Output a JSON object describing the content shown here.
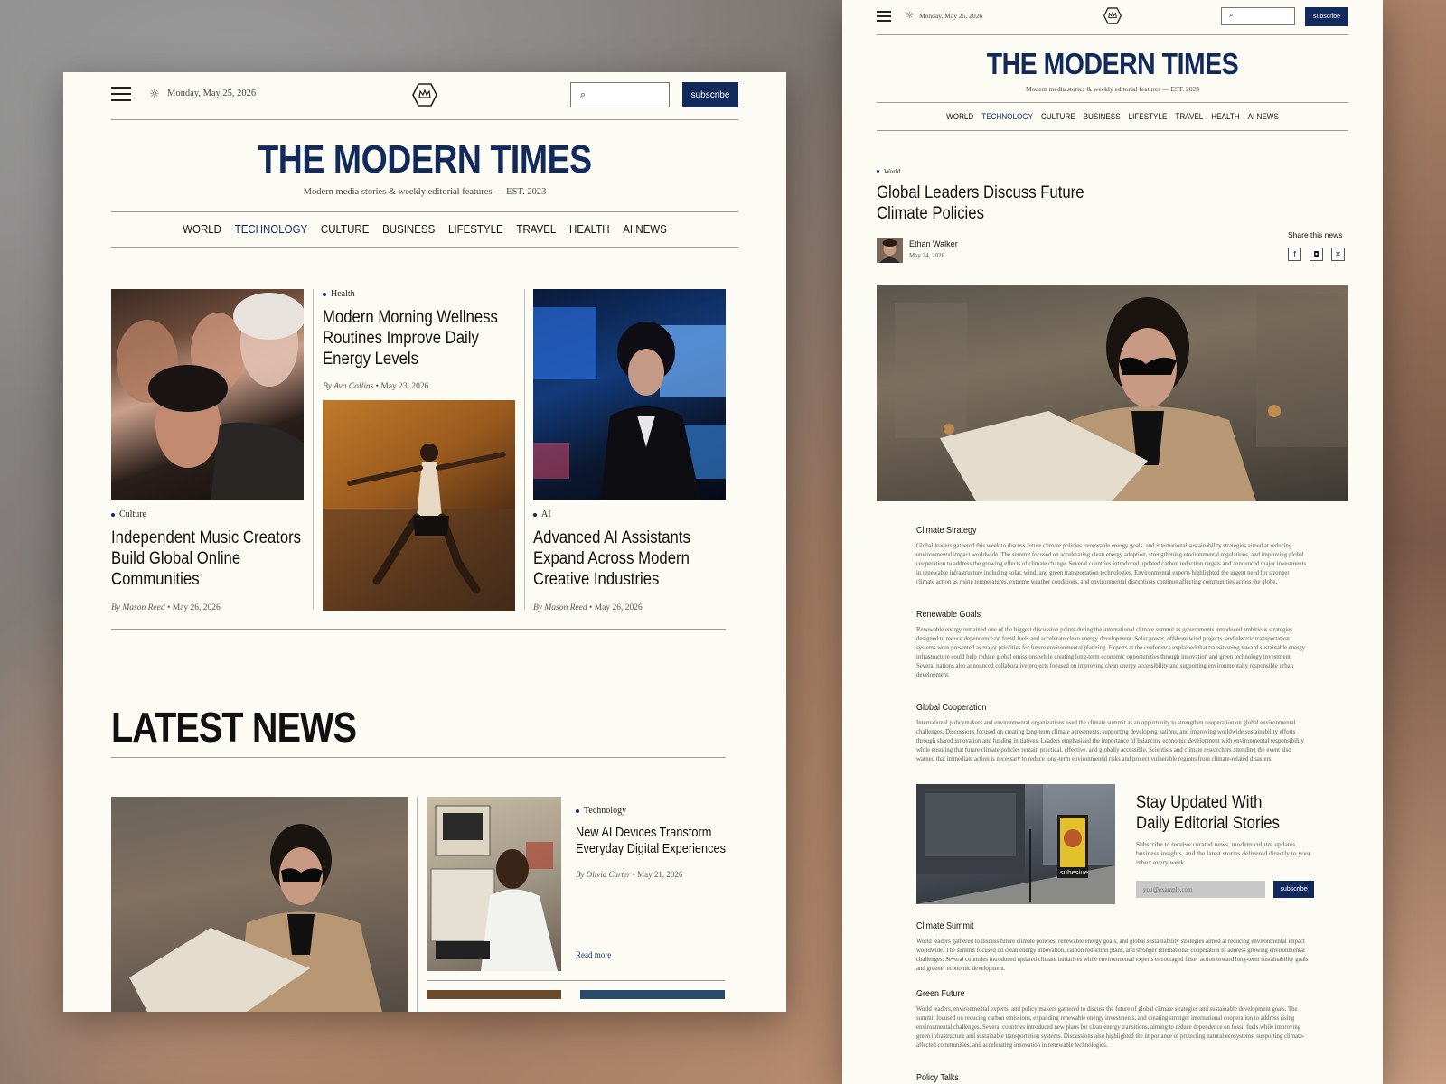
{
  "site": {
    "name": "THE MODERN TIMES",
    "tagline": "Modern media stories & weekly editorial features — EST. 2023",
    "date": "Monday, May 25, 2026",
    "subscribe_label": "subscribe",
    "search_placeholder": ""
  },
  "nav": [
    "WORLD",
    "TECHNOLOGY",
    "CULTURE",
    "BUSINESS",
    "LIFESTYLE",
    "TRAVEL",
    "HEALTH",
    "AI NEWS"
  ],
  "nav_active": "TECHNOLOGY",
  "featured": [
    {
      "category": "Culture",
      "title": "Independent Music Creators Build Global Online Communities",
      "author": "By Mason Reed",
      "date": "May 26, 2026"
    },
    {
      "category": "Health",
      "title": "Modern Morning Wellness Routines Improve Daily Energy Levels",
      "author": "By Ava Collins",
      "date": "May 23, 2026"
    },
    {
      "category": "AI",
      "title": "Advanced AI Assistants Expand Across Modern Creative Industries",
      "author": "By Mason Reed",
      "date": "May 26, 2026"
    }
  ],
  "latest": {
    "heading": "LATEST NEWS",
    "story": {
      "category": "Technology",
      "title": "New AI Devices Transform Everyday Digital Experiences",
      "author": "By Olivia Carter",
      "date": "May 21, 2026",
      "read_more": "Read more"
    }
  },
  "article": {
    "category": "World",
    "title": "Global Leaders Discuss Future Climate Policies",
    "author": "Ethan Walker",
    "date": "May 24, 2026",
    "share_label": "Share this news",
    "sections": [
      {
        "heading": "Climate Strategy",
        "body": "Global leaders gathered this week to discuss future climate policies, renewable energy goals, and international sustainability strategies aimed at reducing environmental impact worldwide. The summit focused on accelerating clean energy adoption, strengthening environmental regulations, and improving global cooperation to address the growing effects of climate change. Several countries introduced updated carbon reduction targets and announced major investments in renewable infrastructure including solar, wind, and green transportation technologies. Environmental experts highlighted the urgent need for stronger climate action as rising temperatures, extreme weather conditions, and environmental disruptions continue affecting communities across the globe."
      },
      {
        "heading": "Renewable Goals",
        "body": "Renewable energy remained one of the biggest discussion points during the international climate summit as governments introduced ambitious strategies designed to reduce dependence on fossil fuels and accelerate clean energy development. Solar power, offshore wind projects, and electric transportation systems were presented as major priorities for future environmental planning. Experts at the conference explained that transitioning toward sustainable energy infrastructure could help reduce global emissions while creating long-term economic opportunities through innovation and green technology investment. Several nations also announced collaborative projects focused on improving clean energy accessibility and supporting environmentally responsible urban development."
      },
      {
        "heading": "Global Cooperation",
        "body": "International policymakers and environmental organizations used the climate summit as an opportunity to strengthen cooperation on global environmental challenges. Discussions focused on creating long-term climate agreements, supporting developing nations, and improving worldwide sustainability efforts through shared innovation and funding initiatives. Leaders emphasized the importance of balancing economic development with environmental responsibility while ensuring that future climate policies remain practical, effective, and globally accessible. Scientists and climate researchers attending the event also warned that immediate action is necessary to reduce long-term environmental risks and protect vulnerable regions from climate-related disasters."
      },
      {
        "heading": "Climate Summit",
        "body": "World leaders gathered to discuss future climate policies, renewable energy goals, and global sustainability strategies aimed at reducing environmental impact worldwide. The summit focused on clean energy innovation, carbon reduction plans, and stronger international cooperation to address growing environmental challenges. Several countries introduced updated climate initiatives while environmental experts encouraged faster action toward long-term sustainability goals and greener economic development."
      },
      {
        "heading": "Green Future",
        "body": "World leaders, environmental experts, and policy makers gathered to discuss the future of global climate strategies and sustainable development goals. The summit focused on reducing carbon emissions, expanding renewable energy investments, and creating stronger international cooperation to address rising environmental challenges. Several countries introduced new plans for clean energy transitions, aiming to reduce dependence on fossil fuels while improving green infrastructure and sustainable transportation systems. Discussions also highlighted the importance of protecting natural ecosystems, supporting climate-affected communities, and accelerating innovation in renewable technologies."
      },
      {
        "heading": "Policy Talks",
        "body": ""
      }
    ],
    "newsletter": {
      "title": "Stay Updated With Daily Editorial Stories",
      "desc": "Subscribe to receive curated news, modern culture updates, business insights, and the latest stories delivered directly to your inbox every week.",
      "placeholder": "you@example.com",
      "button": "subscribe",
      "poster_text": "subesiue"
    }
  },
  "icons": {
    "menu": "hamburger-icon",
    "theme": "sun-icon",
    "search": "search-icon",
    "logo": "crown-hexagon-logo",
    "facebook": "facebook-icon",
    "instagram": "instagram-icon",
    "x": "x-icon"
  },
  "colors": {
    "brand": "#12295b",
    "paper": "#fdfcf4"
  }
}
